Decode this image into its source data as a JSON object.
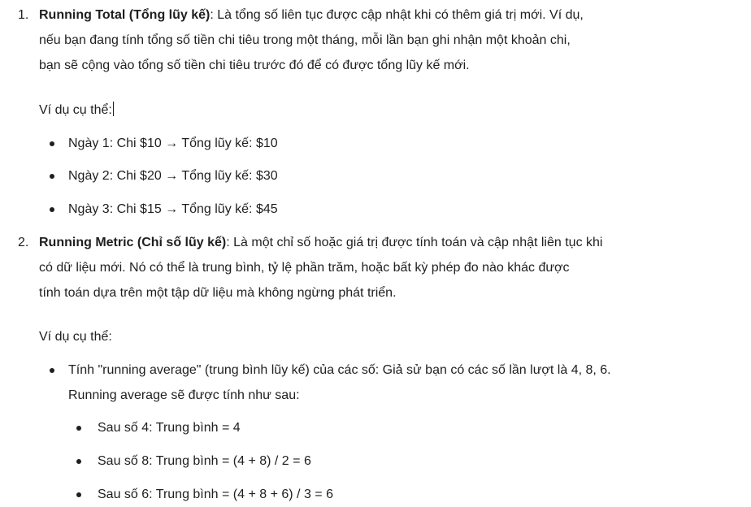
{
  "item1": {
    "marker": "1.",
    "term": "Running Total (Tổng lũy kế)",
    "lines": [
      ": Là tổng số liên tục được cập nhật khi có thêm giá trị mới. Ví dụ,",
      "nếu bạn đang tính tổng số tiền chi tiêu trong một tháng, mỗi lần bạn ghi nhận một khoản chi,",
      "bạn sẽ cộng vào tổng số tiền chi tiêu trước đó để có được tổng lũy kế mới."
    ],
    "example_label": "Ví dụ cụ thể:",
    "bullets": [
      "Ngày 1: Chi $10 → Tổng lũy kế: $10",
      "Ngày 2: Chi $20 → Tổng lũy kế: $30",
      "Ngày 3: Chi $15 → Tổng lũy kế: $45"
    ]
  },
  "item2": {
    "marker": "2.",
    "term": "Running Metric (Chỉ số lũy kế)",
    "lines": [
      ": Là một chỉ số hoặc giá trị được tính toán và cập nhật liên tục khi",
      "có dữ liệu mới. Nó có thể là trung bình, tỷ lệ phần trăm, hoặc bất kỳ phép đo nào khác được",
      "tính toán dựa trên một tập dữ liệu mà không ngừng phát triển."
    ],
    "example_label": "Ví dụ cụ thể:",
    "bullet_lines": [
      "Tính \"running average\" (trung bình lũy kế) của các số: Giả sử bạn có các số lần lượt là 4, 8, 6.",
      "Running average sẽ được tính như sau:"
    ],
    "sub_bullets": [
      "Sau số 4: Trung bình = 4",
      "Sau số 8: Trung bình = (4 + 8) / 2 = 6",
      "Sau số 6: Trung bình = (4 + 8 + 6) / 3 = 6"
    ]
  }
}
